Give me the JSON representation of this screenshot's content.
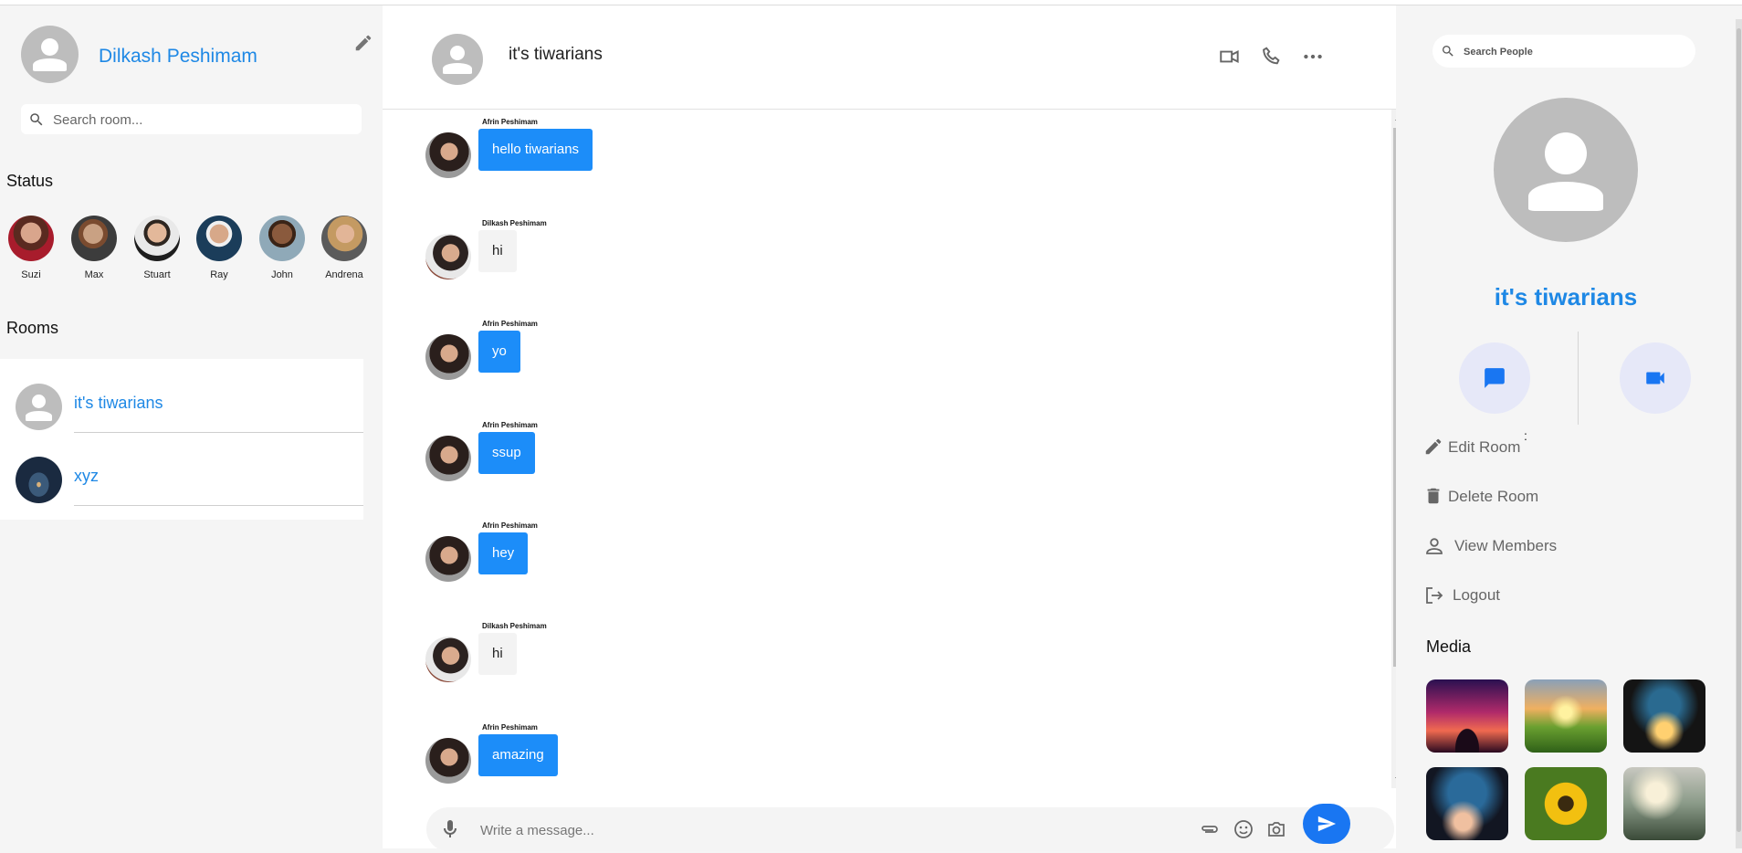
{
  "user": {
    "name": "Dilkash Peshimam"
  },
  "left": {
    "search_placeholder": "Search room...",
    "status_title": "Status",
    "statuses": [
      {
        "name": "Suzi"
      },
      {
        "name": "Max"
      },
      {
        "name": "Stuart"
      },
      {
        "name": "Ray"
      },
      {
        "name": "John"
      },
      {
        "name": "Andrena"
      }
    ],
    "rooms_title": "Rooms",
    "rooms": [
      {
        "name": "it's tiwarians"
      },
      {
        "name": "xyz"
      }
    ]
  },
  "chat": {
    "title": "it's tiwarians",
    "messages": [
      {
        "sender": "Afrin Peshimam",
        "text": "hello tiwarians"
      },
      {
        "sender": "Dilkash Peshimam",
        "text": "hi"
      },
      {
        "sender": "Afrin Peshimam",
        "text": "yo"
      },
      {
        "sender": "Afrin Peshimam",
        "text": "ssup"
      },
      {
        "sender": "Afrin Peshimam",
        "text": "hey"
      },
      {
        "sender": "Dilkash Peshimam",
        "text": "hi"
      },
      {
        "sender": "Afrin Peshimam",
        "text": "amazing"
      }
    ],
    "composer_placeholder": "Write a message..."
  },
  "right": {
    "search_placeholder": "Search People",
    "room_title": "it's tiwarians",
    "colon": ":",
    "menu": {
      "edit": "Edit Room",
      "delete": "Delete Room",
      "members": "View Members",
      "logout": "Logout"
    },
    "media_title": "Media"
  },
  "colors": {
    "accent": "#1e88e5",
    "bubble_own": "#1c8df9",
    "bubble_other": "#f3f3f3",
    "send": "#1976f2"
  }
}
